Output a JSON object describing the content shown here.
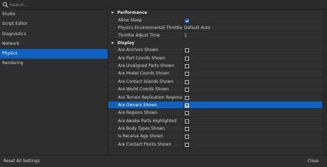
{
  "search": {
    "placeholder": "Search..."
  },
  "sidebar": {
    "items": [
      {
        "label": "Studio"
      },
      {
        "label": "Script Editor"
      },
      {
        "label": "Diagnostics"
      },
      {
        "label": "Network"
      },
      {
        "label": "Physics",
        "selected": true
      },
      {
        "label": "Rendering"
      }
    ]
  },
  "sections": {
    "performance": {
      "title": "Performance",
      "rows": [
        {
          "label": "Allow Sleep",
          "type": "checkbox",
          "checked": true
        },
        {
          "label": "Physics Environmental Throttle",
          "type": "text",
          "value": "Default Auto"
        },
        {
          "label": "Throttle Adjust Time",
          "type": "text",
          "value": "1"
        }
      ]
    },
    "display": {
      "title": "Display",
      "rows": [
        {
          "label": "Are Anchors Shown",
          "checked": false
        },
        {
          "label": "Are Part Coords Shown",
          "checked": false
        },
        {
          "label": "Are Unaligned Parts Shown",
          "checked": false
        },
        {
          "label": "Are Model Coords Shown",
          "checked": false
        },
        {
          "label": "Are Contact Islands Shown",
          "checked": false
        },
        {
          "label": "Are World Coords Shown",
          "checked": false
        },
        {
          "label": "Are Terrain Replication Regions Shown",
          "checked": false
        },
        {
          "label": "Are Owners Shown",
          "checked": true,
          "selected": true
        },
        {
          "label": "Are Regions Shown",
          "checked": false
        },
        {
          "label": "Are Awake Parts Highlighted",
          "checked": false
        },
        {
          "label": "Are Body Types Shown",
          "checked": false
        },
        {
          "label": "Is Receive Age Shown",
          "checked": false
        },
        {
          "label": "Are Contact Points Shown",
          "checked": false
        }
      ]
    }
  },
  "footer": {
    "reset_label": "Reset All Settings",
    "close_label": "Close"
  },
  "colors": {
    "accent": "#0e63c2",
    "background": "#2e2e2e"
  }
}
